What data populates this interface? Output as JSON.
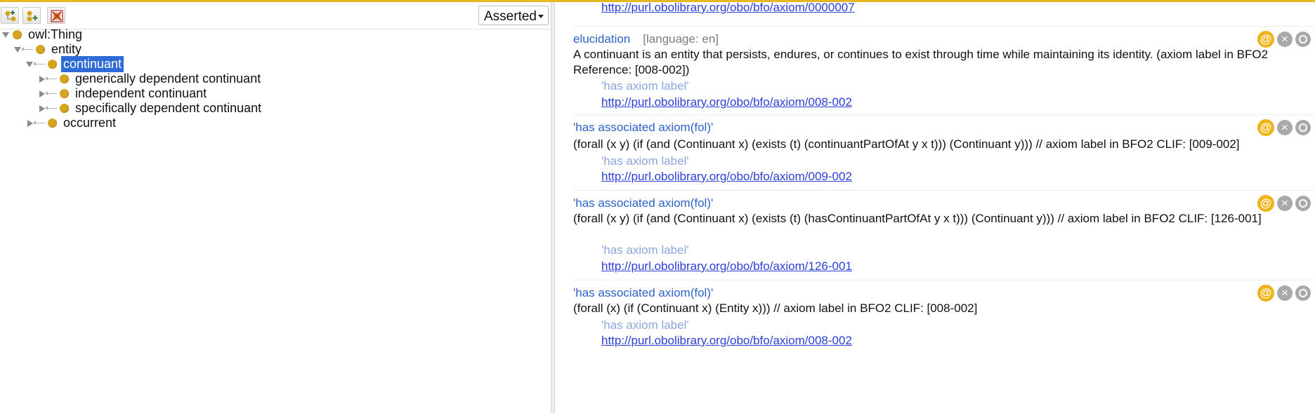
{
  "toolbar": {
    "buttons": [
      "add-subclass-icon",
      "add-sibling-icon",
      "delete-class-icon"
    ],
    "view_mode": "Asserted"
  },
  "tree": [
    {
      "label": "owl:Thing",
      "level": 0,
      "expanded": true
    },
    {
      "label": "entity",
      "level": 1,
      "expanded": true
    },
    {
      "label": "continuant",
      "level": 2,
      "expanded": true,
      "selected": true
    },
    {
      "label": "generically dependent continuant",
      "level": 3,
      "expanded": false
    },
    {
      "label": "independent continuant",
      "level": 3,
      "expanded": false
    },
    {
      "label": "specifically dependent continuant",
      "level": 3,
      "expanded": false
    },
    {
      "label": "occurrent",
      "level": 2,
      "expanded": false
    }
  ],
  "annotations": {
    "top_link": "http://purl.obolibrary.org/obo/bfo/axiom/0000007",
    "items": [
      {
        "property": "elucidation",
        "language": "[language: en]",
        "text": "A continuant is an entity that persists, endures, or continues to exist through time while maintaining its identity. (axiom label in BFO2 Reference: [008-002])",
        "sub_property": "'has axiom label'",
        "sub_link": "http://purl.obolibrary.org/obo/bfo/axiom/008-002"
      },
      {
        "property": "'has associated axiom(fol)'",
        "language": "",
        "text": "(forall (x y) (if (and (Continuant x) (exists (t) (continuantPartOfAt y x t))) (Continuant y))) // axiom label in BFO2 CLIF: [009-002]",
        "sub_property": "'has axiom label'",
        "sub_link": "http://purl.obolibrary.org/obo/bfo/axiom/009-002"
      },
      {
        "property": "'has associated axiom(fol)'",
        "language": "",
        "text": "(forall (x y) (if (and (Continuant x) (exists (t) (hasContinuantPartOfAt y x t))) (Continuant y))) // axiom label in BFO2 CLIF: [126-001]",
        "sub_property": "'has axiom label'",
        "sub_link": "http://purl.obolibrary.org/obo/bfo/axiom/126-001"
      },
      {
        "property": "'has associated axiom(fol)'",
        "language": "",
        "text": "(forall (x) (if (Continuant x) (Entity x))) // axiom label in BFO2 CLIF: [008-002]",
        "sub_property": "'has axiom label'",
        "sub_link": "http://purl.obolibrary.org/obo/bfo/axiom/008-002"
      }
    ],
    "button_labels": {
      "annotate": "@",
      "delete": "×"
    }
  },
  "colors": {
    "accent": "#e7b623",
    "class_dot": "#d6a51f",
    "selection": "#2e6bd6",
    "property_blue": "#2d62c8",
    "link": "#2d40d6"
  }
}
